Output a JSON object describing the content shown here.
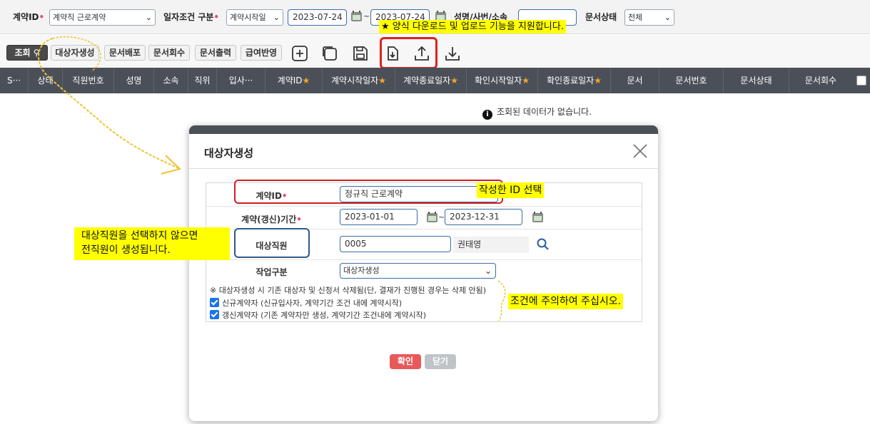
{
  "filters": {
    "contract_id_label": "계약ID",
    "contract_id_value": "계약직 근로계약",
    "date_cond_label": "일자조건 구분",
    "date_cond_value": "계약시작일",
    "date_from": "2023-07-24",
    "date_to": "2023-07-24",
    "name_label": "성명/사번/소속",
    "status_label": "문서상태",
    "status_value": "전체"
  },
  "toolbar": {
    "search": "조회",
    "create_target": "대상자생성",
    "distribute": "문서배포",
    "recall": "문서회수",
    "print": "문서출력",
    "payroll": "급여반영"
  },
  "table": {
    "columns": [
      "S···",
      "상태",
      "직원번호",
      "성명",
      "소속",
      "직위",
      "입사···",
      "계약ID",
      "계약시작일자",
      "계약종료일자",
      "확인시작일자",
      "확인종료일자",
      "문서",
      "문서번호",
      "문서상태",
      "문서회수"
    ],
    "empty_message": "조회된 데이터가 없습니다."
  },
  "modal": {
    "title": "대상자생성",
    "contract_id_label": "계약ID",
    "contract_id_value": "정규직 근로계약",
    "period_label": "계약(갱신)기간",
    "period_from": "2023-01-01",
    "period_to": "2023-12-31",
    "target_label": "대상직원",
    "target_id": "0005",
    "target_name": "권태영",
    "work_type_label": "작업구분",
    "work_type_value": "대상자생성",
    "note": "※ 대상자생성 시 기존 대상자 및 신청서 삭제됨(단, 결재가 진행된 경우는 삭제 안됨)",
    "option_new": "신규계약자 (신규입사자, 계약기간 조건 내에 계약시작)",
    "option_renew": "갱신계약자 (기존 계약자만 생성, 계약기간 조건내에 계약시작)",
    "confirm": "확인",
    "close": "닫기"
  },
  "callouts": {
    "top": "★ 양식 다운로드 및 업로드 기능을 지원합니다.",
    "select_id": "작성한 ID 선택",
    "target_line1": "대상직원을 선택하지 않으면",
    "target_line2": "전직원이 생성됩니다.",
    "conditions": "조건에 주의하여 주십시오."
  },
  "icons": {
    "add": "add-icon",
    "copy": "copy-icon",
    "save": "save-icon",
    "download_template": "download-template-icon",
    "upload": "upload-icon",
    "download": "download-icon"
  }
}
